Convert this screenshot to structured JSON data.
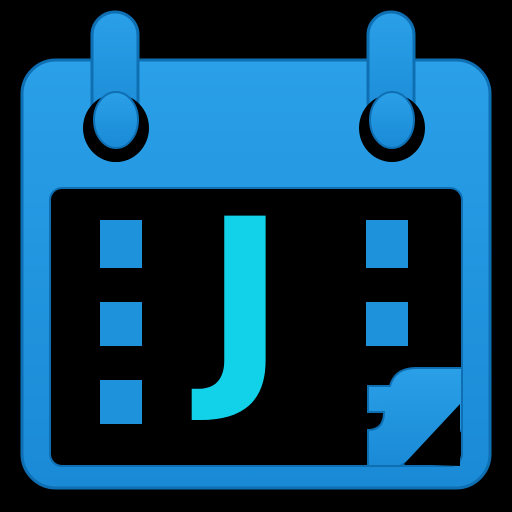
{
  "icon": {
    "letter": "J",
    "name": "calendar-icon"
  },
  "colors": {
    "background": "#000000",
    "calendar_blue": "#1a8fdc",
    "calendar_blue_light": "#2ea3ea",
    "calendar_blue_dark": "#0f6fb3",
    "letter_cyan": "#12d2ea"
  }
}
